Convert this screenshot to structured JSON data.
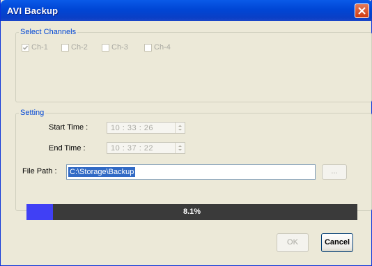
{
  "window": {
    "title": "AVI Backup"
  },
  "channels": {
    "legend": "Select Channels",
    "items": [
      {
        "label": "Ch-1",
        "checked": true
      },
      {
        "label": "Ch-2",
        "checked": false
      },
      {
        "label": "Ch-3",
        "checked": false
      },
      {
        "label": "Ch-4",
        "checked": false
      }
    ]
  },
  "setting": {
    "legend": "Setting",
    "start_time_label": "Start Time :",
    "start_time_value": "10 : 33 : 26",
    "end_time_label": "End Time :",
    "end_time_value": "10 : 37 : 22",
    "file_path_label": "File Path :",
    "file_path_value": "C:\\Storage\\Backup",
    "browse_label": "..."
  },
  "progress": {
    "percent": 8.1,
    "text": "8.1%"
  },
  "buttons": {
    "ok": "OK",
    "cancel": "Cancel"
  },
  "colors": {
    "titlebar": "#0046d5",
    "progress_fill": "#4040f5",
    "progress_track": "#3a3a3a",
    "legend_text": "#0046d5"
  }
}
